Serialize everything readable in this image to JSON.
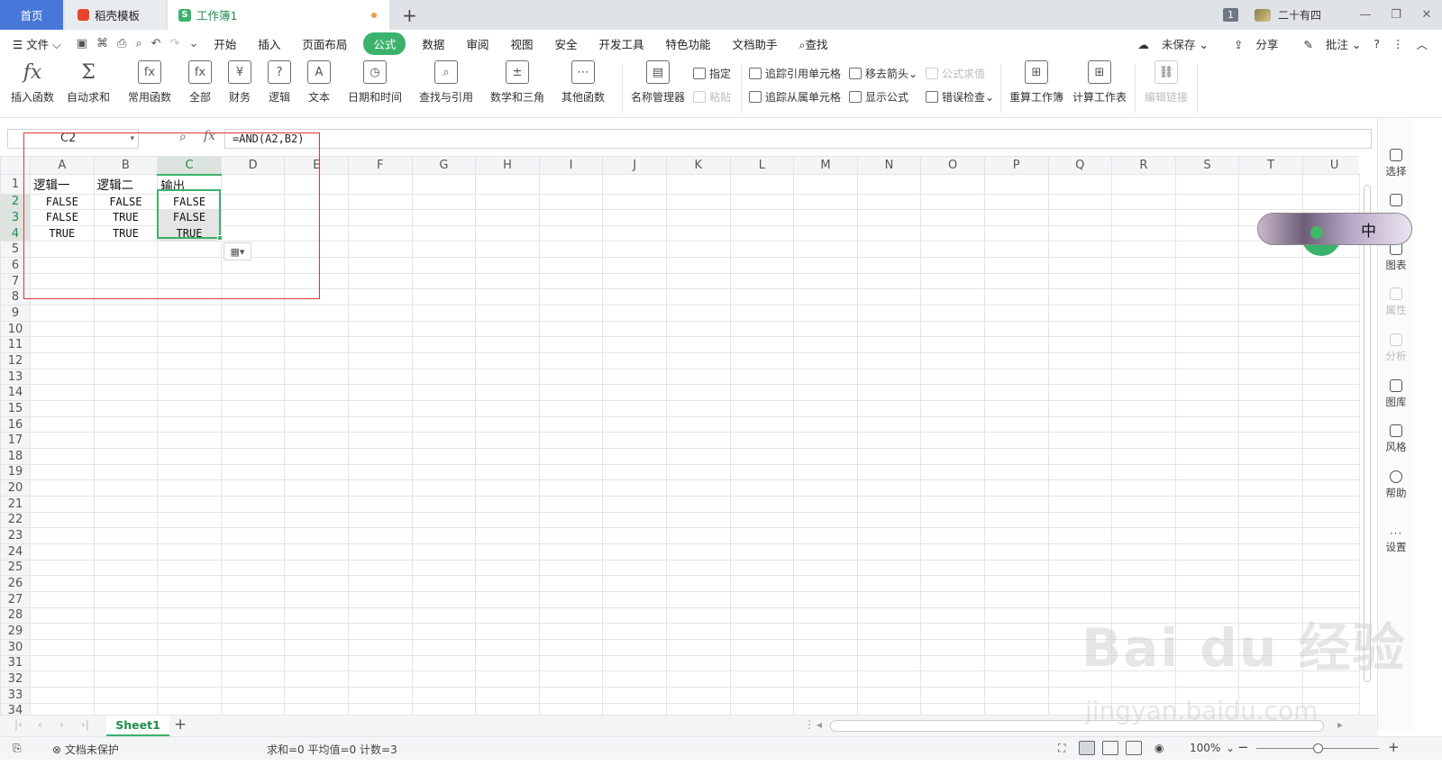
{
  "titlebar": {
    "tabs": {
      "home": "首页",
      "templates": "稻壳模板",
      "workbook": "工作簿1"
    },
    "badge": "1",
    "user": "二十有四"
  },
  "menu": {
    "file": "文件",
    "items": [
      "开始",
      "插入",
      "页面布局",
      "公式",
      "数据",
      "审阅",
      "视图",
      "安全",
      "开发工具",
      "特色功能",
      "文档助手"
    ],
    "active": "公式",
    "search": "查找",
    "unsaved": "未保存",
    "share": "分享",
    "comment": "批注"
  },
  "ribbon": {
    "insert_func": "插入函数",
    "autosum": "自动求和",
    "common": "常用函数",
    "all": "全部",
    "finance": "财务",
    "logic": "逻辑",
    "text": "文本",
    "datetime": "日期和时间",
    "lookup": "查找与引用",
    "math": "数学和三角",
    "other": "其他函数",
    "name_mgr": "名称管理器",
    "assign": "指定",
    "paste": "粘贴",
    "trace_prec": "追踪引用单元格",
    "trace_dep": "追踪从属单元格",
    "remove_arrows": "移去箭头",
    "show_formula": "显示公式",
    "eval_formula": "公式求值",
    "error_check": "错误检查",
    "recalc_book": "重算工作簿",
    "calc_sheet": "计算工作表",
    "edit_links": "编辑链接"
  },
  "formula_bar": {
    "name_box": "C2",
    "formula": "=AND(A2,B2)",
    "fx": "fx"
  },
  "grid": {
    "columns": [
      "A",
      "B",
      "C",
      "D",
      "E",
      "F",
      "G",
      "H",
      "I",
      "J",
      "K",
      "L",
      "M",
      "N",
      "O",
      "P",
      "Q",
      "R",
      "S",
      "T",
      "U"
    ],
    "rows": 34,
    "cells": [
      [
        "逻辑一",
        "逻辑二",
        "输出"
      ],
      [
        "FALSE",
        "FALSE",
        "FALSE"
      ],
      [
        "FALSE",
        "TRUE",
        "FALSE"
      ],
      [
        "TRUE",
        "TRUE",
        "TRUE"
      ]
    ]
  },
  "side_panel": [
    "选择",
    "图表",
    "属性",
    "分析",
    "图库",
    "风格",
    "帮助",
    "设置"
  ],
  "float_widget": {
    "label": "中"
  },
  "sheets": {
    "active": "Sheet1"
  },
  "status": {
    "protect": "文档未保护",
    "stats": "求和=0  平均值=0  计数=3",
    "zoom": "100%"
  },
  "watermark": {
    "main": "Bai du 经验",
    "sub": "jingyan.baidu.com"
  }
}
